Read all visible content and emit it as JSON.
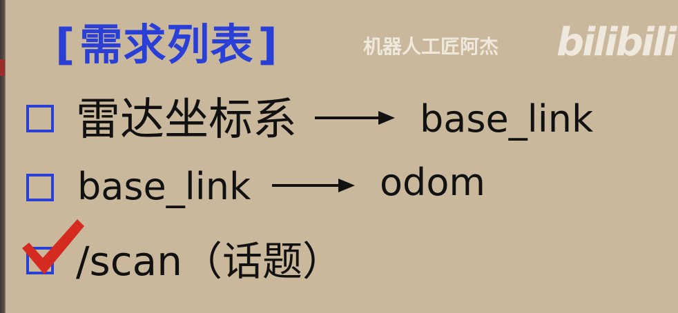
{
  "title": {
    "open_bracket": "[",
    "text": "需求列表",
    "close_bracket": "]",
    "color": "#2a3fd6"
  },
  "watermark": {
    "author": "机器人工匠阿杰",
    "platform_logo": "bilibili",
    "color": "#efe8dd"
  },
  "requirements": [
    {
      "label": "雷达坐标系",
      "arrow_icon": "right-arrow-icon",
      "target": "base_link",
      "checked": false
    },
    {
      "label": "base_link",
      "arrow_icon": "right-arrow-icon",
      "target": "odom",
      "checked": false
    },
    {
      "label": "/scan（话题）",
      "checked": true,
      "check_icon": "red-checkmark-icon"
    }
  ],
  "colors": {
    "background": "#c9b89b",
    "checkbox_border": "#2a3fd6",
    "checkmark": "#d42a1f",
    "text": "#111111"
  }
}
